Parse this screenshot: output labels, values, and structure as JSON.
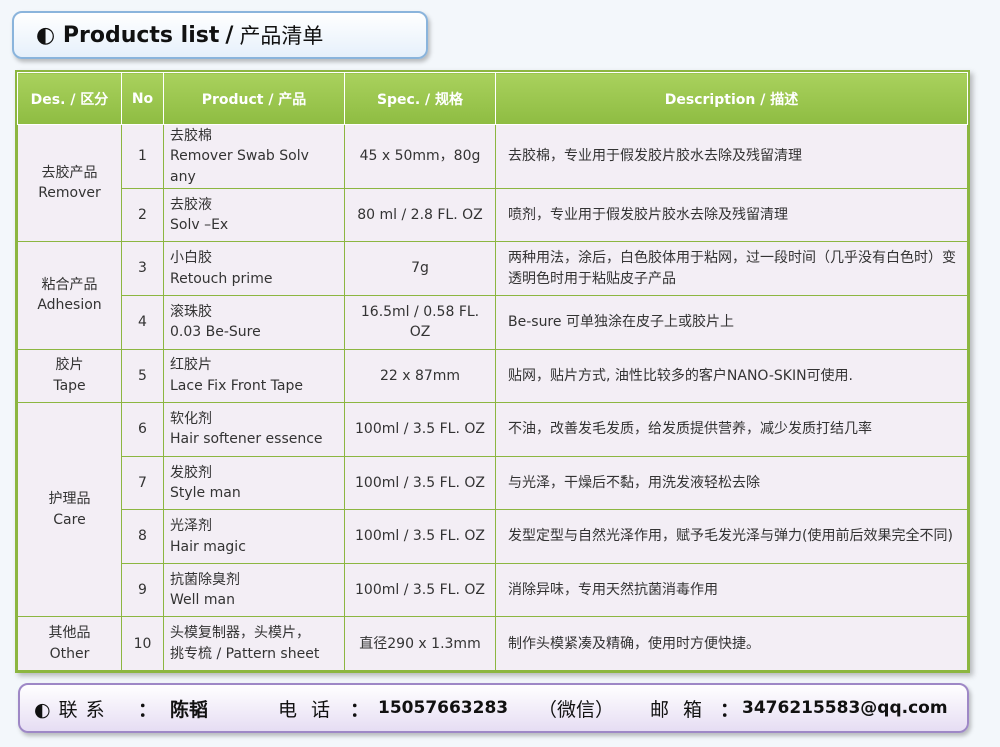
{
  "title": {
    "icon": "half-circle-icon",
    "glyph": "◐",
    "en": "Products list",
    "sep": "/",
    "cn": "产品清单"
  },
  "headers": [
    "Des. / 区分",
    "No",
    "Product / 产品",
    "Spec. / 规格",
    "Description / 描述"
  ],
  "categories": [
    {
      "cn": "去胶产品",
      "en": "Remover"
    },
    {
      "cn": "粘合产品",
      "en": "Adhesion"
    },
    {
      "cn": "胶片",
      "en": "Tape"
    },
    {
      "cn": "护理品",
      "en": "Care"
    },
    {
      "cn": "其他品",
      "en": "Other"
    }
  ],
  "rows": [
    {
      "no": "1",
      "p1": "去胶棉",
      "p2": "Remover Swab  Solv",
      "p3": "any",
      "spec": "45 x 50mm，80g",
      "desc": "去胶棉，专业用于假发胶片胶水去除及残留清理"
    },
    {
      "no": "2",
      "p1": "去胶液",
      "p2": "Solv –Ex",
      "spec": "80 ml / 2.8 FL. OZ",
      "desc": "喷剂，专业用于假发胶片胶水去除及残留清理"
    },
    {
      "no": "3",
      "p1": "小白胶",
      "p2": "Retouch prime",
      "spec": "7g",
      "desc": "两种用法，涂后，白色胶体用于粘网，过一段时间（几乎没有白色时）变透明色时用于粘贴皮子产品"
    },
    {
      "no": "4",
      "p1": "滚珠胶",
      "p2": "0.03 Be-Sure",
      "spec": "16.5ml / 0.58 FL. OZ",
      "desc": "Be-sure 可单独涂在皮子上或胶片上"
    },
    {
      "no": "5",
      "p1": "红胶片",
      "p2": "Lace Fix Front Tape",
      "spec": "22 x 87mm",
      "desc": "贴网，贴片方式, 油性比较多的客户NANO-SKIN可使用."
    },
    {
      "no": "6",
      "p1": "软化剂",
      "p2": "Hair softener essence",
      "spec": "100ml / 3.5 FL. OZ",
      "desc": "不油，改善发毛发质，给发质提供营养，减少发质打结几率"
    },
    {
      "no": "7",
      "p1": "发胶剂",
      "p2": "Style man",
      "spec": "100ml  / 3.5 FL. OZ",
      "desc": "与光泽，干燥后不黏，用洗发液轻松去除"
    },
    {
      "no": "8",
      "p1": "光泽剂",
      "p2": "Hair magic",
      "spec": "100ml / 3.5 FL. OZ",
      "desc": "发型定型与自然光泽作用，赋予毛发光泽与弹力(使用前后效果完全不同)"
    },
    {
      "no": "9",
      "p1": "抗菌除臭剂",
      "p2": "Well man",
      "spec": "100ml / 3.5 FL. OZ",
      "desc": "消除异味，专用天然抗菌消毒作用"
    },
    {
      "no": "10",
      "p1": "头模复制器，头模片，",
      "p2": "挑专梳 / Pattern sheet",
      "spec": "直径290 x 1.3mm",
      "desc": "制作头模紧凑及精确，使用时方便快捷。"
    }
  ],
  "contact": {
    "icon": "half-circle-icon",
    "label": "◐联系",
    "colon": "：",
    "name": "陈韬",
    "phone_label": "电话",
    "phone": "15057663283",
    "wechat": "（微信）",
    "mail_label": "邮箱",
    "email": "3476215583@qq.com"
  },
  "colors": {
    "header_green": "#8ebc42",
    "border_green": "#8cb640",
    "contact_purple": "#9e88c6"
  }
}
